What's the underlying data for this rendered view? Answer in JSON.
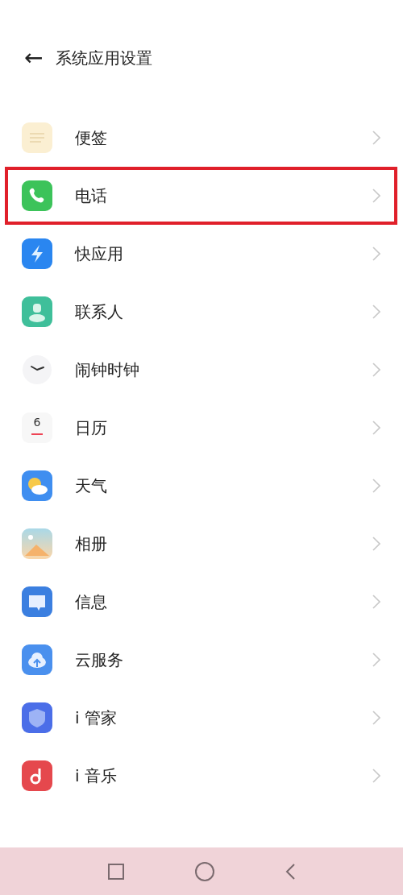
{
  "header": {
    "back": "←",
    "title": "系统应用设置"
  },
  "items": [
    {
      "label": "便签",
      "kind": "notes",
      "highlighted": false
    },
    {
      "label": "电话",
      "kind": "phone",
      "highlighted": true
    },
    {
      "label": "快应用",
      "kind": "quickapp",
      "highlighted": false
    },
    {
      "label": "联系人",
      "kind": "contacts",
      "highlighted": false
    },
    {
      "label": "闹钟时钟",
      "kind": "clock",
      "highlighted": false
    },
    {
      "label": "日历",
      "kind": "calendar",
      "icon_text": "6",
      "highlighted": false
    },
    {
      "label": "天气",
      "kind": "weather",
      "highlighted": false
    },
    {
      "label": "相册",
      "kind": "gallery",
      "highlighted": false
    },
    {
      "label": "信息",
      "kind": "messages",
      "highlighted": false
    },
    {
      "label": "云服务",
      "kind": "cloud",
      "highlighted": false
    },
    {
      "label": "i 管家",
      "kind": "manager",
      "highlighted": false
    },
    {
      "label": "i 音乐",
      "kind": "music",
      "highlighted": false
    }
  ]
}
